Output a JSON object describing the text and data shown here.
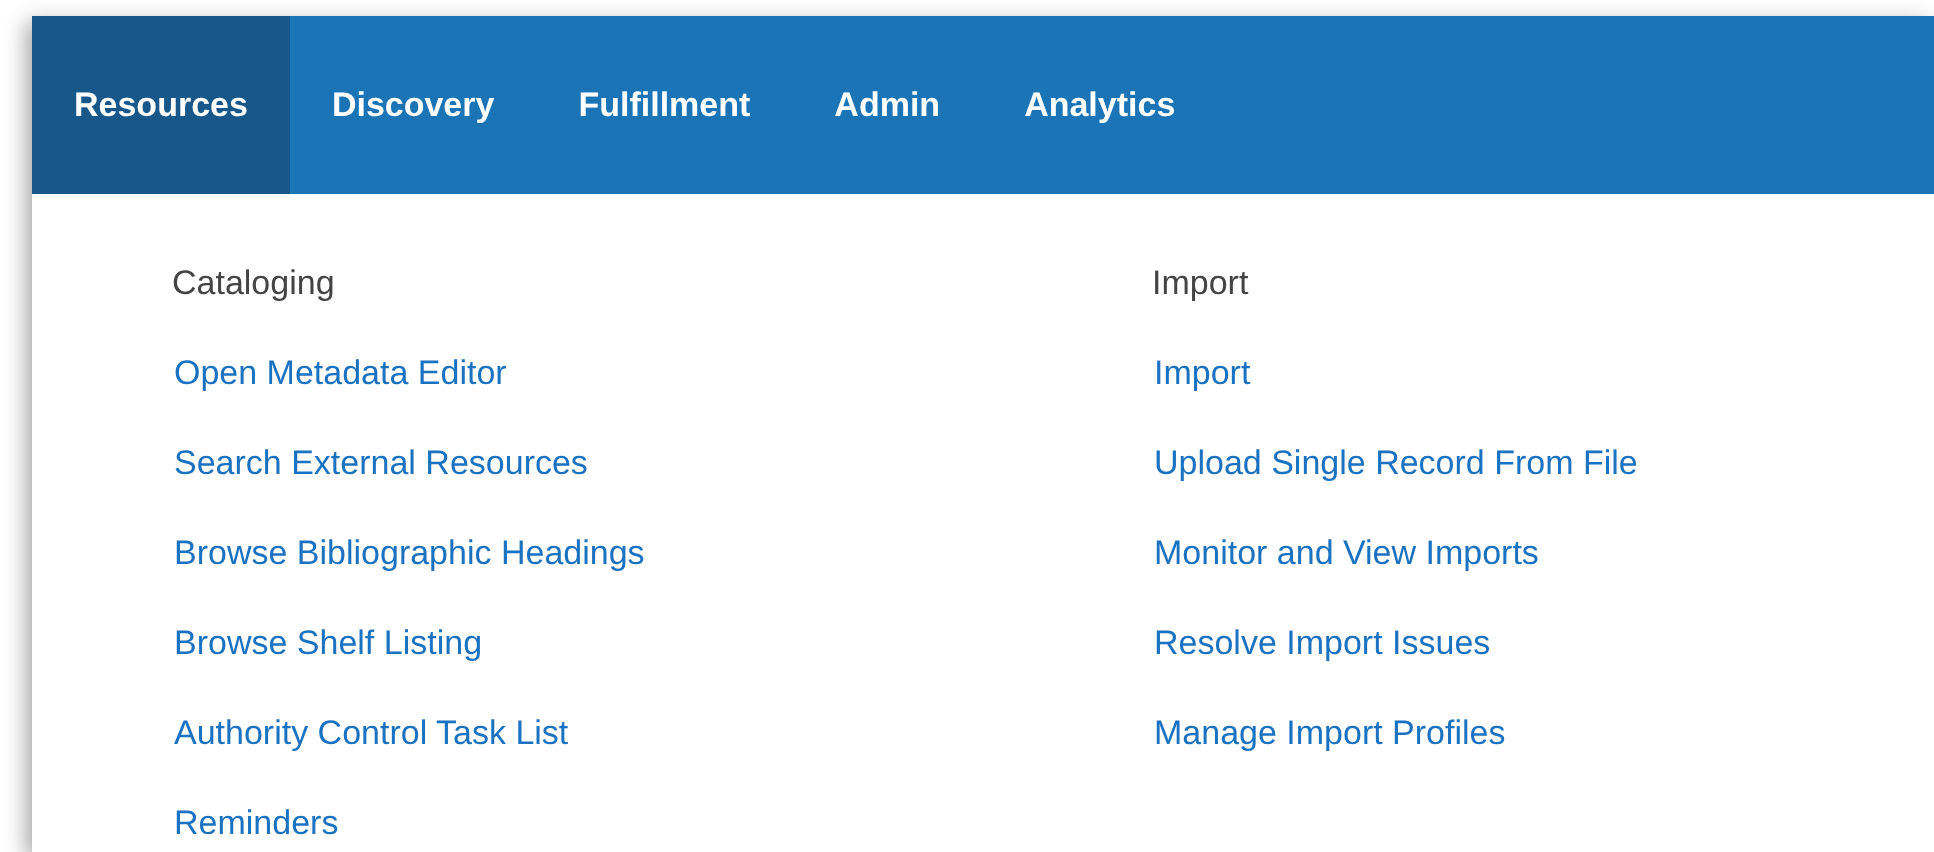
{
  "tabs": [
    {
      "label": "Resources",
      "selected": true
    },
    {
      "label": "Discovery",
      "selected": false
    },
    {
      "label": "Fulfillment",
      "selected": false
    },
    {
      "label": "Admin",
      "selected": false
    },
    {
      "label": "Analytics",
      "selected": false
    }
  ],
  "menu": {
    "columns": [
      {
        "heading": "Cataloging",
        "links": [
          "Open Metadata Editor",
          "Search External Resources",
          "Browse Bibliographic Headings",
          "Browse Shelf Listing",
          "Authority Control Task List",
          "Reminders"
        ]
      },
      {
        "heading": "Import",
        "links": [
          "Import",
          "Upload Single Record From File",
          "Monitor and View Imports",
          "Resolve Import Issues",
          "Manage Import Profiles"
        ]
      }
    ]
  }
}
